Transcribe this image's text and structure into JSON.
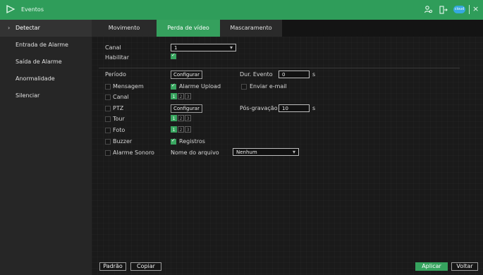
{
  "window": {
    "title": "Eventos",
    "icons": {
      "logo": "logo-icon",
      "user": "user-icon",
      "logout": "logout-icon",
      "cloud": "cloud-icon",
      "close": "close-icon"
    },
    "cloud_label": "cloud"
  },
  "sidebar": {
    "items": [
      {
        "label": "Detectar",
        "active": true
      },
      {
        "label": "Entrada de Alarme"
      },
      {
        "label": "Saída de Alarme"
      },
      {
        "label": "Anormalidade"
      },
      {
        "label": "Silenciar"
      }
    ]
  },
  "tabs": [
    {
      "label": "Movimento"
    },
    {
      "label": "Perda de vídeo",
      "active": true
    },
    {
      "label": "Mascaramento"
    }
  ],
  "form": {
    "canal_label": "Canal",
    "canal_value": "1",
    "habilitar_label": "Habilitar",
    "periodo_label": "Período",
    "configurar_label": "Configurar",
    "dur_evento_label": "Dur. Evento",
    "dur_evento_value": "0",
    "unit_s": "s",
    "mensagem_label": "Mensagem",
    "alarme_upload_label": "Alarme Upload",
    "enviar_email_label": "Enviar e-mail",
    "canal2_label": "Canal",
    "ptz_label": "PTZ",
    "pos_gravacao_label": "Pós-gravação",
    "pos_gravacao_value": "10",
    "tour_label": "Tour",
    "foto_label": "Foto",
    "buzzer_label": "Buzzer",
    "registros_label": "Registros",
    "alarme_sonoro_label": "Alarme Sonoro",
    "nome_arquivo_label": "Nome do arquivo",
    "nome_arquivo_value": "Nenhum",
    "nums": [
      "1",
      "2",
      "3"
    ]
  },
  "footer": {
    "padrao": "Padrão",
    "copiar": "Copiar",
    "aplicar": "Aplicar",
    "voltar": "Voltar"
  },
  "colors": {
    "accent": "#39a660",
    "topbar": "#2f9d5a",
    "background": "#1c1c1c"
  }
}
